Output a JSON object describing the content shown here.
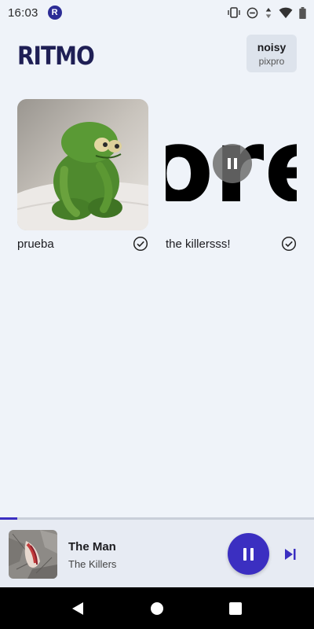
{
  "status_bar": {
    "time": "16:03",
    "app_icon_letter": "R"
  },
  "header": {
    "logo": "RITMO",
    "user": {
      "name": "noisy",
      "service": "pixpro"
    }
  },
  "playlists": [
    {
      "name": "prueba",
      "selected": true
    },
    {
      "name": "the killersss!",
      "selected": true,
      "cover_text": "ore"
    }
  ],
  "player": {
    "title": "The Man",
    "artist": "The Killers",
    "progress": 0.055,
    "state": "playing"
  },
  "colors": {
    "accent": "#3b2fc1",
    "background": "#eff3f9",
    "logo": "#1f1f55"
  }
}
